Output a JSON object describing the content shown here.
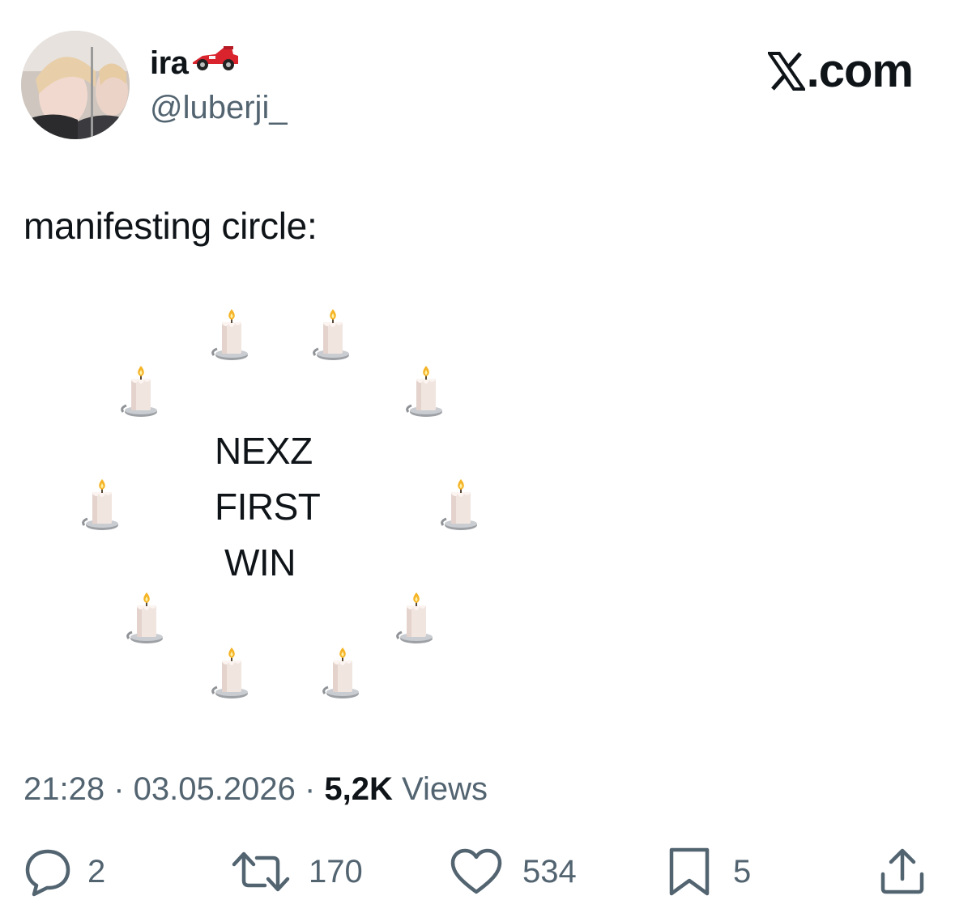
{
  "author": {
    "display_name": "ira",
    "handle": "@luberji_"
  },
  "source": {
    "site": "com"
  },
  "tweet": {
    "text": "manifesting circle:",
    "center_lines": [
      "NEXZ",
      "FIRST",
      "WIN"
    ],
    "candle_icon": "candle-emoji",
    "candle_count": 10
  },
  "meta": {
    "time": "21:28",
    "separator": " · ",
    "date": "03.05.2026",
    "views_count": "5,2K",
    "views_label": " Views"
  },
  "actions": {
    "replies": "2",
    "retweets": "170",
    "likes": "534",
    "bookmarks": "5"
  },
  "colors": {
    "text": "#0f1419",
    "secondary": "#536471"
  }
}
